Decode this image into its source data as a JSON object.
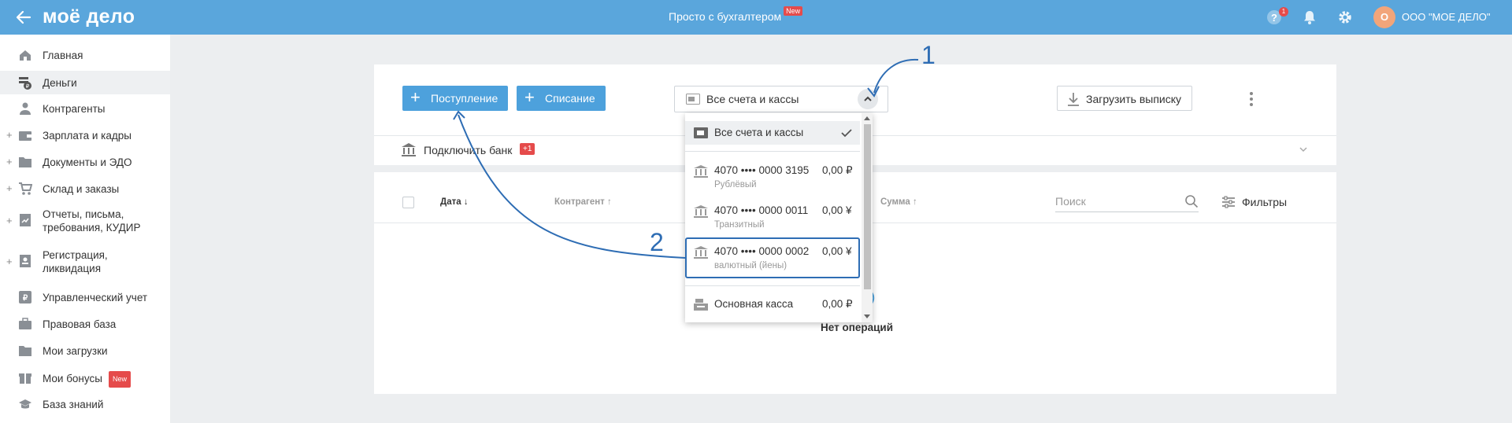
{
  "header": {
    "logo": "моё дело",
    "promo": "Просто с бухгалтером",
    "promo_badge": "New",
    "help_count": "1",
    "avatar_letter": "О",
    "company": "ООО \"МОЕ ДЕЛО\""
  },
  "sidebar": {
    "items": [
      {
        "label": "Главная"
      },
      {
        "label": "Деньги"
      },
      {
        "label": "Контрагенты"
      },
      {
        "label": "Зарплата и кадры"
      },
      {
        "label": "Документы и ЭДО"
      },
      {
        "label": "Склад и заказы"
      },
      {
        "label": "Отчеты, письма, требования, КУДИР"
      },
      {
        "label": "Регистрация, ликвидация"
      },
      {
        "label": "Управленческий учет"
      },
      {
        "label": "Правовая база"
      },
      {
        "label": "Мои загрузки"
      },
      {
        "label": "Мои бонусы",
        "badge": "New"
      },
      {
        "label": "База знаний"
      }
    ]
  },
  "toolbar": {
    "income_label": "Поступление",
    "expense_label": "Списание",
    "account_select": "Все счета и кассы",
    "upload_label": "Загрузить выписку"
  },
  "bank_bar": {
    "label": "Подключить банк",
    "badge": "+1"
  },
  "table": {
    "columns": [
      "Дата",
      "Контрагент",
      "Сумма"
    ],
    "search_placeholder": "Поиск",
    "filters_label": "Фильтры",
    "empty_text": "Нет операций"
  },
  "dropdown": {
    "all_label": "Все счета и кассы",
    "accounts": [
      {
        "number": "4070 •••• 0000 3195",
        "amount": "0,00 ₽",
        "type": "Рублёвый"
      },
      {
        "number": "4070 •••• 0000 0011",
        "amount": "0,00 ¥",
        "type": "Транзитный"
      },
      {
        "number": "4070 •••• 0000 0002",
        "amount": "0,00 ¥",
        "type": "валютный (йены)"
      }
    ],
    "cash": {
      "label": "Основная касса",
      "amount": "0,00 ₽"
    }
  },
  "annotations": {
    "one": "1",
    "two": "2"
  },
  "colors": {
    "header": "#5aa6dc",
    "primary_button": "#4da1dc",
    "highlight": "#2e6db4",
    "badge_red": "#e54b4b"
  }
}
